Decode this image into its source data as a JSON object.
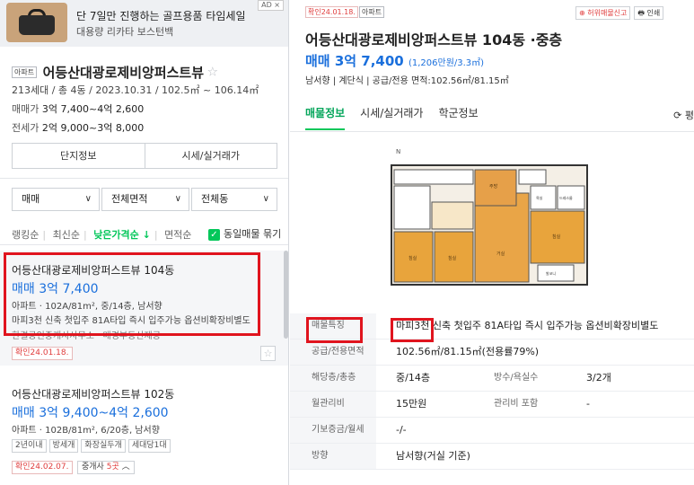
{
  "ad": {
    "title": "단 7일만 진행하는 골프용품 타임세일",
    "subtitle": "대용량 리카타 보스턴백",
    "badge": "AD ×"
  },
  "complex": {
    "type_tag": "아파트",
    "name": "어등산대광로제비앙퍼스트뷰",
    "info": "213세대 / 총 4동 / 2023.10.31 / 102.5㎡ ~ 106.14㎡",
    "sale_label": "매매가",
    "sale_value": "3억 7,400~4억 2,600",
    "lease_label": "전세가",
    "lease_value": "2억 9,000~3억 8,000"
  },
  "buttons": {
    "complex_info": "단지정보",
    "market_price": "시세/실거래가"
  },
  "filters": {
    "trade_type": "매매",
    "area": "전체면적",
    "building": "전체동"
  },
  "sort": {
    "items": [
      "랭킹순",
      "최신순",
      "낮은가격순 ↓",
      "면적순"
    ],
    "same_listing": "동일매물 묶기"
  },
  "listings": [
    {
      "title": "어등산대광로제비앙퍼스트뷰 104동",
      "price": "매매 3억 7,400",
      "spec": "아파트 · 102A/81m², 중/14층, 남서향",
      "desc": "마피3천 신축 첫입주 81A타입 즉시 입주가능 옵션비확장비별도",
      "hint": "한결공인중개사사무소 · 매경부동산제공",
      "confirm": "확인24.01.18."
    },
    {
      "title": "어등산대광로제비앙퍼스트뷰 102동",
      "price": "매매 3억 9,400~4억 2,600",
      "spec": "아파트 · 102B/81m², 6/20층, 남서향",
      "chips": [
        "2년이내",
        "방세개",
        "화장실두개",
        "세대당1대"
      ],
      "confirm": "확인24.02.07.",
      "agent_prefix": "중개사",
      "agent_count": "5곳",
      "agent_suffix": "︿"
    }
  ],
  "detail": {
    "confirm": "확인24.01.18.",
    "type_tag": "아파트",
    "report": "⊕ 허위매물신고",
    "print": "🖶 인쇄",
    "title": "어등산대광로제비앙퍼스트뷰 104동 ·중층",
    "price": "매매 3억 7,400",
    "price_per": "(1,206만원/3.3㎡)",
    "meta": "남서향 | 계단식 | 공급/전용 면적:102.56㎡/81.15㎡",
    "tabs": [
      "매물정보",
      "시세/실거래가",
      "학군정보"
    ],
    "tab_right": "⟳ 평",
    "rows": [
      {
        "label": "매물특징",
        "value": "마피3천 신축 첫입주 81A타입 즉시 입주가능 옵션비확장비별도"
      },
      {
        "label": "공급/전용면적",
        "value": "102.56㎡/81.15㎡(전용률79%)"
      },
      {
        "label": "해당층/총층",
        "value": "중/14층",
        "label2": "방수/욕실수",
        "value2": "3/2개"
      },
      {
        "label": "월관리비",
        "value": "15만원",
        "label2": "관리비 포함",
        "value2": "-"
      },
      {
        "label": "기보증금/월세",
        "value": "-/-"
      },
      {
        "label": "방향",
        "value": "남서향(거실 기준)"
      }
    ],
    "plan": {
      "north": "N",
      "rooms": [
        "침실",
        "침실",
        "거실",
        "주방",
        "침실",
        "드레스룸",
        "욕실",
        "발코니"
      ]
    }
  },
  "colors": {
    "accent_green": "#03c75a",
    "price_blue": "#1a6fdc",
    "highlight_red": "#e0141e"
  }
}
